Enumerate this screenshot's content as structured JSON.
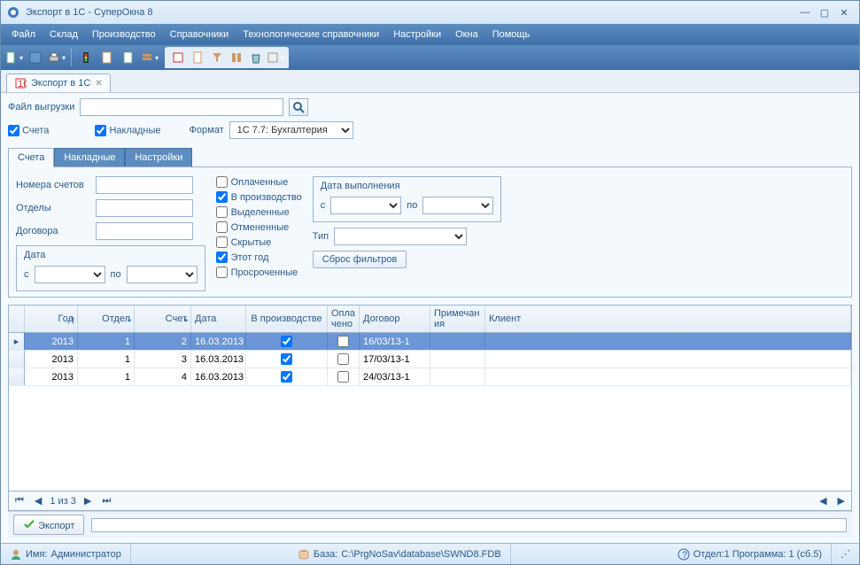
{
  "window": {
    "title": "Экспорт в 1С - СуперОкна 8"
  },
  "menu": [
    "Файл",
    "Склад",
    "Производство",
    "Справочники",
    "Технологические справочники",
    "Настройки",
    "Окна",
    "Помощь"
  ],
  "doctab": {
    "label": "Экспорт в 1С"
  },
  "file_row": {
    "label": "Файл выгрузки",
    "value": ""
  },
  "options": {
    "accounts_label": "Счета",
    "accounts_checked": true,
    "invoices_label": "Накладные",
    "invoices_checked": true,
    "format_label": "Формат",
    "format_value": "1С 7.7: Бухгалтерия"
  },
  "inner_tabs": [
    "Счета",
    "Накладные",
    "Настройки"
  ],
  "filters": {
    "nums_label": "Номера счетов",
    "nums_value": "",
    "dept_label": "Отделы",
    "dept_value": "",
    "contract_label": "Договора",
    "contract_value": "",
    "date_group": "Дата",
    "from_label": "с",
    "to_label": "по",
    "checks": {
      "paid": "Оплаченные",
      "paid_checked": false,
      "inprod": "В производство",
      "inprod_checked": true,
      "selected": "Выделенные",
      "selected_checked": false,
      "cancelled": "Отмененные",
      "cancelled_checked": false,
      "hidden": "Скрытые",
      "hidden_checked": false,
      "thisyear": "Этот год",
      "thisyear_checked": true,
      "overdue": "Просроченные",
      "overdue_checked": false
    },
    "exec_group": "Дата выполнения",
    "exec_from": "с",
    "exec_to": "по",
    "type_label": "Тип",
    "type_value": "",
    "reset_btn": "Сброс фильтров"
  },
  "grid": {
    "cols": [
      "Год",
      "Отдел",
      "Счет",
      "Дата",
      "В производстве",
      "Опла чено",
      "Договор",
      "Примечан ия",
      "Клиент"
    ],
    "rows": [
      {
        "god": "2013",
        "otd": "1",
        "sch": "2",
        "dat": "16.03.2013",
        "prod": true,
        "opl": false,
        "dog": "16/03/13-1",
        "prim": "",
        "kli": "",
        "sel": true
      },
      {
        "god": "2013",
        "otd": "1",
        "sch": "3",
        "dat": "16.03.2013",
        "prod": true,
        "opl": false,
        "dog": "17/03/13-1",
        "prim": "",
        "kli": "",
        "sel": false
      },
      {
        "god": "2013",
        "otd": "1",
        "sch": "4",
        "dat": "16.03.2013",
        "prod": true,
        "opl": false,
        "dog": "24/03/13-1",
        "prim": "",
        "kli": "",
        "sel": false
      }
    ]
  },
  "pager": {
    "text": "1 из 3"
  },
  "export_btn": "Экспорт",
  "status": {
    "user_label": "Имя:",
    "user": "Администратор",
    "db_label": "База:",
    "db": "C:\\PrgNoSav\\database\\SWND8.FDB",
    "dept": "Отдел:1 Программа: 1 (сб.5)"
  }
}
